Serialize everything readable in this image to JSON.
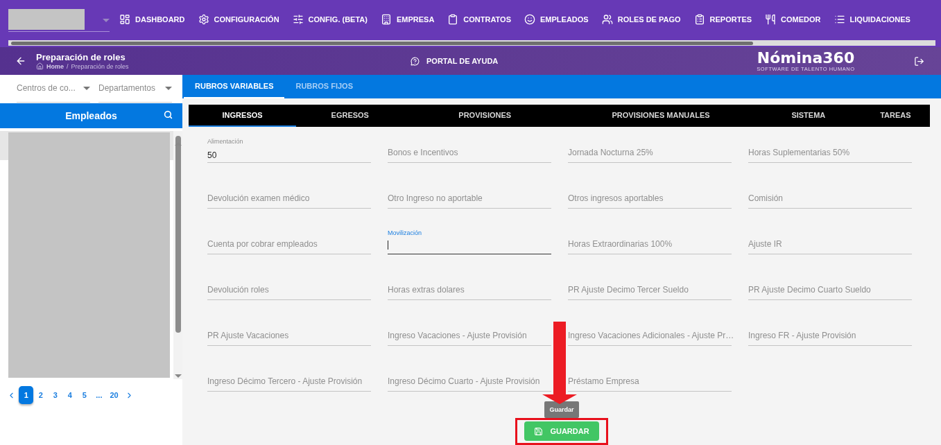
{
  "nav": {
    "items": [
      {
        "label": "DASHBOARD",
        "kind": "dashboard"
      },
      {
        "label": "CONFIGURACIÓN",
        "kind": "settings"
      },
      {
        "label": "CONFIG. (BETA)",
        "kind": "sliders"
      },
      {
        "label": "EMPRESA",
        "kind": "building"
      },
      {
        "label": "CONTRATOS",
        "kind": "clipboard"
      },
      {
        "label": "EMPLEADOS",
        "kind": "face"
      },
      {
        "label": "ROLES DE PAGO",
        "kind": "users"
      },
      {
        "label": "REPORTES",
        "kind": "report"
      },
      {
        "label": "COMEDOR",
        "kind": "utensils"
      },
      {
        "label": "LIQUIDACIONES",
        "kind": "list"
      }
    ]
  },
  "header": {
    "title": "Preparación de roles",
    "breadcrumb": [
      "Home",
      "Preparación de roles"
    ],
    "breadcrumb_separator": "/",
    "help": "PORTAL DE AYUDA",
    "logo": "Nómina360",
    "logo_tagline": "SOFTWARE DE TALENTO HUMANO"
  },
  "sidebar": {
    "filters": [
      {
        "label": "Centros de co..."
      },
      {
        "label": "Departamentos"
      }
    ],
    "title": "Empleados",
    "pagination": [
      {
        "label": "1",
        "selected": true
      },
      {
        "label": "2",
        "selected": false
      },
      {
        "label": "3",
        "selected": false
      },
      {
        "label": "4",
        "selected": false
      },
      {
        "label": "5",
        "selected": false
      },
      {
        "label": "...",
        "selected": false
      },
      {
        "label": "20",
        "selected": false
      }
    ]
  },
  "tabs": [
    {
      "label": "RUBROS VARIABLES",
      "selected": true
    },
    {
      "label": "RUBROS FIJOS",
      "selected": false
    }
  ],
  "subtabs": [
    {
      "label": "INGRESOS",
      "selected": true
    },
    {
      "label": "EGRESOS",
      "selected": false
    },
    {
      "label": "PROVISIONES",
      "selected": false
    },
    {
      "label": "PROVISIONES MANUALES",
      "selected": false
    },
    {
      "label": "SISTEMA",
      "selected": false
    },
    {
      "label": "TAREAS",
      "selected": false
    }
  ],
  "fields": [
    {
      "label": "Alimentación",
      "value": "50",
      "focused": false
    },
    {
      "label": "Bonos e Incentivos",
      "focused": false
    },
    {
      "label": "Jornada Nocturna 25%",
      "focused": false
    },
    {
      "label": "Horas Suplementarias 50%",
      "focused": false
    },
    {
      "label": "Devolución examen médico",
      "focused": false
    },
    {
      "label": "Otro Ingreso no aportable",
      "focused": false
    },
    {
      "label": "Otros ingresos aportables",
      "focused": false
    },
    {
      "label": "Comisión",
      "focused": false
    },
    {
      "label": "Cuenta por cobrar empleados",
      "focused": false
    },
    {
      "label": "Movilización",
      "focused": true
    },
    {
      "label": "Horas Extraordinarias 100%",
      "focused": false
    },
    {
      "label": "Ajuste IR",
      "focused": false
    },
    {
      "label": "Devolución roles",
      "focused": false
    },
    {
      "label": "Horas extras dolares",
      "focused": false
    },
    {
      "label": "PR Ajuste Decimo Tercer Sueldo",
      "focused": false
    },
    {
      "label": "PR Ajuste Decimo Cuarto Sueldo",
      "focused": false
    },
    {
      "label": "PR Ajuste Vacaciones",
      "focused": false
    },
    {
      "label": "Ingreso Vacaciones - Ajuste Provisión",
      "focused": false
    },
    {
      "label": "Ingreso Vacaciones Adicionales - Ajuste Pr…",
      "focused": false
    },
    {
      "label": "Ingreso FR - Ajuste Provisión",
      "focused": false
    },
    {
      "label": "Ingreso Décimo Tercero - Ajuste Provisión",
      "focused": false
    },
    {
      "label": "Ingreso Décimo Cuarto - Ajuste Provisión",
      "focused": false
    },
    {
      "label": "Préstamo Empresa",
      "focused": false
    }
  ],
  "tooltip": "Guardar",
  "save_button": "GUARDAR"
}
